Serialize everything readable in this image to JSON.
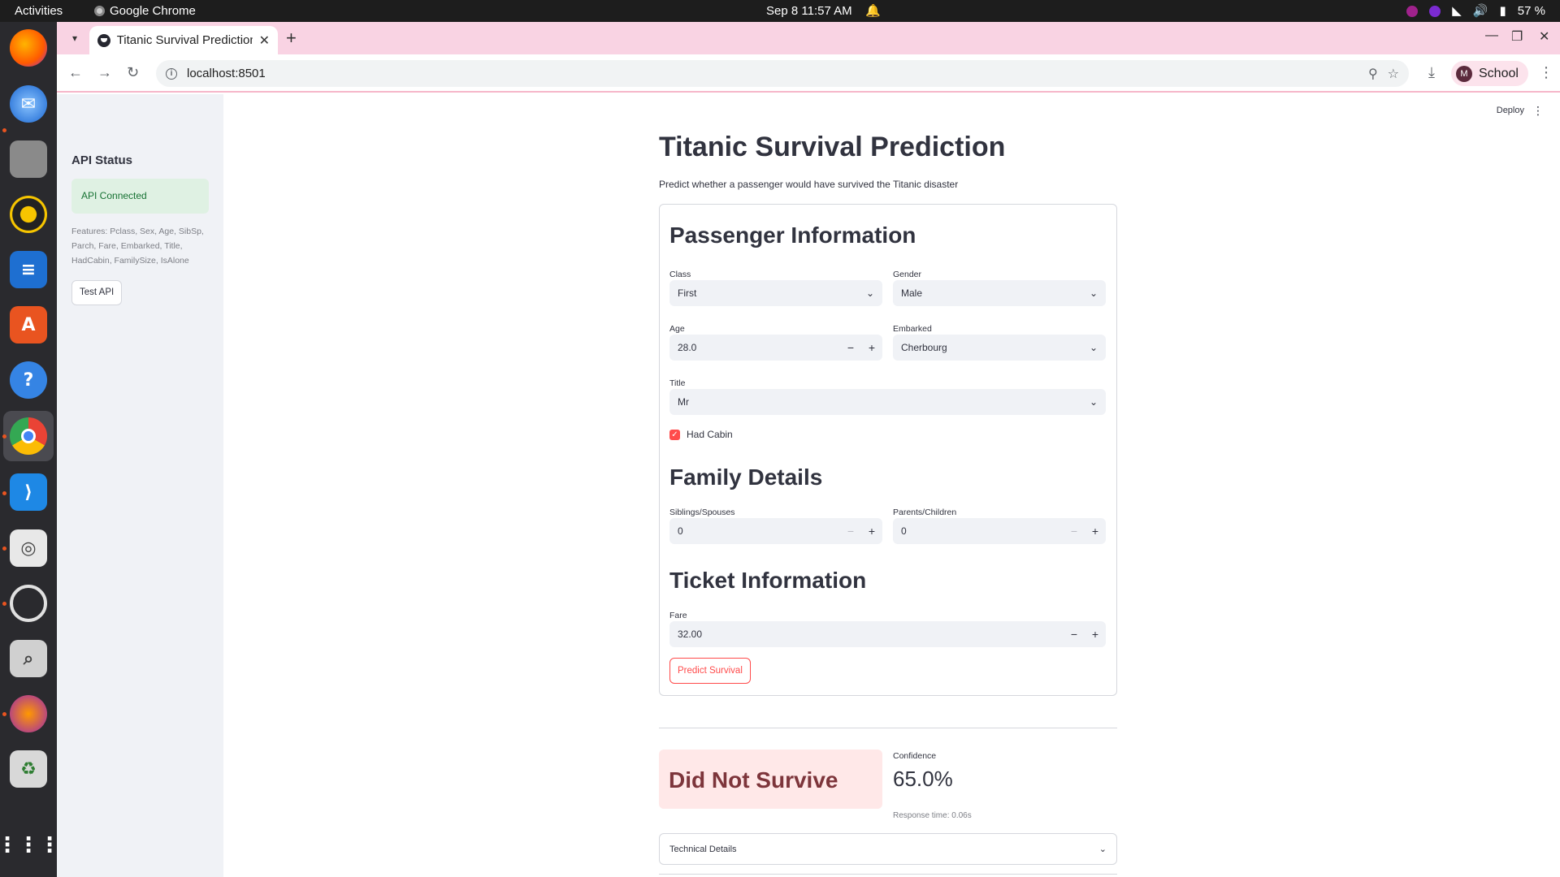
{
  "system_bar": {
    "activities": "Activities",
    "app_name": "Google Chrome",
    "clock": "Sep 8  11:57 AM",
    "battery": "57 %"
  },
  "dock": {
    "apps": [
      "firefox-icon",
      "thunderbird-icon",
      "files-icon",
      "rhythmbox-icon",
      "writer-icon",
      "app-center-icon",
      "help-icon",
      "chrome-icon",
      "vscode-icon",
      "document-viewer-icon",
      "settings-icon",
      "screenshot-icon",
      "app-icon",
      "trash-icon",
      "show-apps-icon"
    ]
  },
  "browser": {
    "tab_title": "Titanic Survival Prediction",
    "url": "localhost:8501",
    "profile_initial": "M",
    "profile_name": "School"
  },
  "sidebar": {
    "title": "API Status",
    "status": "API Connected",
    "features_caption": "Features: Pclass, Sex, Age, SibSp, Parch, Fare, Embarked, Title, HadCabin, FamilySize, IsAlone",
    "test_button": "Test API"
  },
  "header": {
    "deploy": "Deploy"
  },
  "main": {
    "title": "Titanic Survival Prediction",
    "subtitle": "Predict whether a passenger would have survived the Titanic disaster"
  },
  "form": {
    "passenger_section": "Passenger Information",
    "class_label": "Class",
    "class_value": "First",
    "gender_label": "Gender",
    "gender_value": "Male",
    "age_label": "Age",
    "age_value": "28.0",
    "embarked_label": "Embarked",
    "embarked_value": "Cherbourg",
    "title_label": "Title",
    "title_value": "Mr",
    "had_cabin_label": "Had Cabin",
    "had_cabin_checked": true,
    "family_section": "Family Details",
    "sibsp_label": "Siblings/Spouses",
    "sibsp_value": "0",
    "parch_label": "Parents/Children",
    "parch_value": "0",
    "ticket_section": "Ticket Information",
    "fare_label": "Fare",
    "fare_value": "32.00",
    "predict_button": "Predict Survival"
  },
  "result": {
    "outcome": "Did Not Survive",
    "confidence_label": "Confidence",
    "confidence_value": "65.0%",
    "response_time": "Response time: 0.06s",
    "technical_details": "Technical Details"
  },
  "colors": {
    "accent": "#ff4b4b",
    "success_bg": "#dff1e3",
    "error_bg": "#ffe8e8",
    "tabstrip": "#f9d3e3"
  }
}
